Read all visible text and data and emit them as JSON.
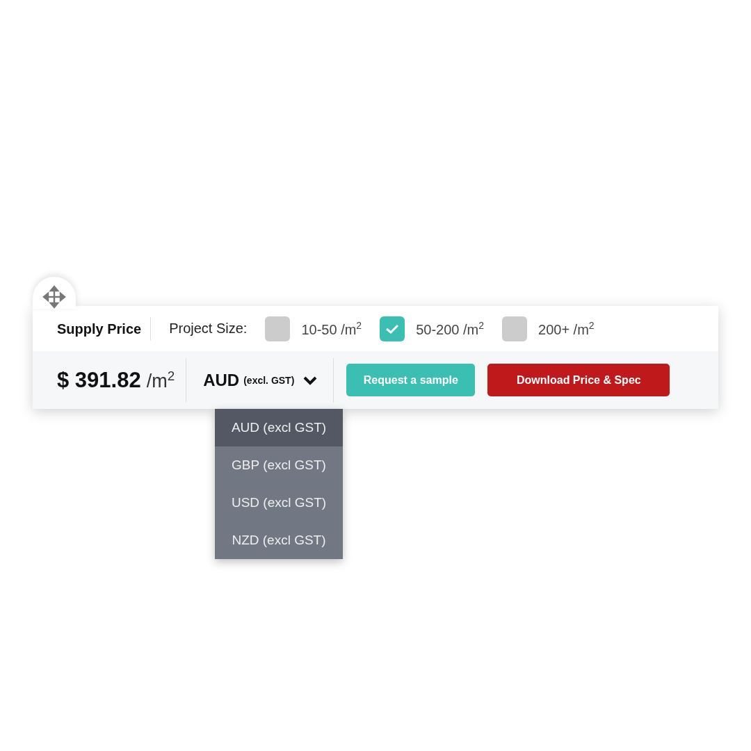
{
  "title": "Supply Price",
  "project_size": {
    "label": "Project Size:",
    "options": [
      {
        "label": "10-50 /m$^{2}$",
        "checked": false
      },
      {
        "label": "50-200 /m$^{2}$",
        "checked": true
      },
      {
        "label": "200+ /m$^{2}$",
        "checked": false
      }
    ]
  },
  "price": {
    "amount": "$ 391.82",
    "unit": "/m$^{2}$"
  },
  "currency": {
    "code": "AUD",
    "note": "(excl. GST)",
    "expanded": true,
    "options": [
      {
        "label": "AUD (excl GST)",
        "selected": true
      },
      {
        "label": "GBP (excl GST)",
        "selected": false
      },
      {
        "label": "USD (excl GST)",
        "selected": false
      },
      {
        "label": "NZD (excl GST)",
        "selected": false
      }
    ]
  },
  "buttons": [
    {
      "label": "Request a sample",
      "kind": "secondary"
    },
    {
      "label": "Download Price & Spec",
      "kind": "primary"
    }
  ]
}
